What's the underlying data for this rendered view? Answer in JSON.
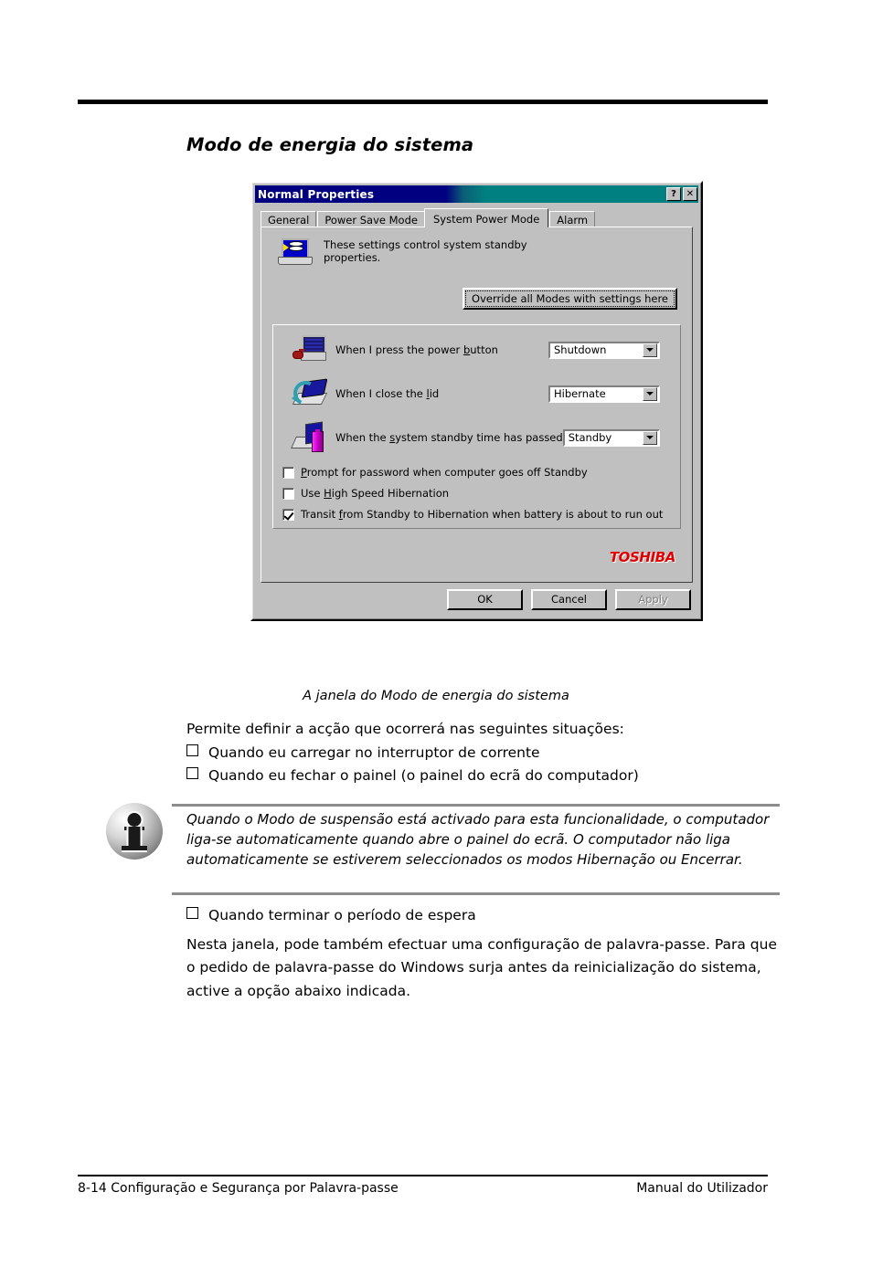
{
  "page": {
    "heading": "Modo de energia do sistema",
    "caption": "A janela do Modo de energia do sistema",
    "footer_left": "8-14  Configuração e Segurança por Palavra-passe",
    "footer_right": "Manual do Utilizador"
  },
  "dialog": {
    "title": "Normal Properties",
    "help_button": "?",
    "close_button": "✕",
    "tabs": [
      {
        "label": "General",
        "selected": false
      },
      {
        "label": "Power Save Mode",
        "selected": false
      },
      {
        "label": "System Power Mode",
        "selected": true
      },
      {
        "label": "Alarm",
        "selected": false
      }
    ],
    "intro_line1": "These settings control system standby",
    "intro_line2": "properties.",
    "override_button": "Override all Modes with settings here",
    "options": [
      {
        "label_pre": "When I press the power ",
        "label_accel": "b",
        "label_post": "utton",
        "value": "Shutdown",
        "icon": "desktop-computer-icon"
      },
      {
        "label_pre": "When I close the ",
        "label_accel": "l",
        "label_post": "id",
        "value": "Hibernate",
        "icon": "close-lid-icon"
      },
      {
        "label_pre": "When the ",
        "label_accel": "s",
        "label_post": "ystem standby time has passed",
        "value": "Standby",
        "icon": "standby-battery-icon"
      }
    ],
    "checkboxes": [
      {
        "label_pre": "",
        "label_accel": "P",
        "label_post": "rompt for password when computer goes off Standby",
        "checked": false
      },
      {
        "label_pre": "Use ",
        "label_accel": "H",
        "label_post": "igh Speed Hibernation",
        "checked": false
      },
      {
        "label_pre": "Transit ",
        "label_accel": "f",
        "label_post": "rom Standby to Hibernation when battery is about to run out",
        "checked": true
      }
    ],
    "brand": "TOSHIBA",
    "buttons": [
      {
        "label": "OK",
        "disabled": false
      },
      {
        "label": "Cancel",
        "disabled": false
      },
      {
        "label": "Apply",
        "disabled": true
      }
    ],
    "colors": {
      "titlebar_start": "#000080",
      "titlebar_end": "#008080",
      "face": "#c0c0c0",
      "brand_red": "#e00000"
    }
  },
  "body": {
    "intro": "Permite definir a acção que ocorrerá nas seguintes situações:",
    "bullets_before_note": [
      "Quando eu carregar no interruptor de corrente",
      "Quando eu fechar o painel (o painel do ecrã do computador)"
    ],
    "note": "Quando o Modo de suspensão está activado para esta funcionalidade, o computador liga-se automaticamente quando abre o painel do ecrã. O computador não liga automaticamente se estiverem seleccionados os modos Hibernação ou Encerrar.",
    "bullets_after_note": [
      "Quando terminar o período de espera"
    ],
    "closing": "Nesta janela, pode também efectuar uma configuração de palavra-passe. Para que o pedido de palavra-passe do Windows surja antes da reinicialização do sistema, active a opção abaixo indicada."
  }
}
